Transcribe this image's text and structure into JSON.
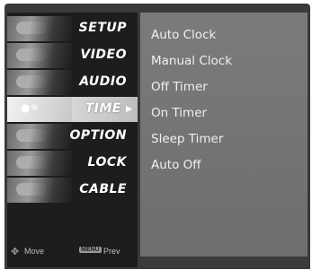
{
  "menu": {
    "items": [
      {
        "label": "SETUP",
        "icon": "setup-icon"
      },
      {
        "label": "VIDEO",
        "icon": "video-icon"
      },
      {
        "label": "AUDIO",
        "icon": "audio-icon"
      },
      {
        "label": "TIME",
        "icon": "time-icon",
        "selected": true
      },
      {
        "label": "OPTION",
        "icon": "option-icon"
      },
      {
        "label": "LOCK",
        "icon": "lock-icon"
      },
      {
        "label": "CABLE",
        "icon": "cable-icon"
      }
    ]
  },
  "submenu": {
    "items": [
      "Auto Clock",
      "Manual Clock",
      "Off Timer",
      "On Timer",
      "Sleep Timer",
      "Auto Off"
    ]
  },
  "help": {
    "move_label": "Move",
    "menu_key": "MENU",
    "prev_label": "Prev"
  },
  "colors": {
    "background": "#3a3a3a",
    "submenu_panel": "#757575",
    "selected_item": "#d9d9d9"
  }
}
